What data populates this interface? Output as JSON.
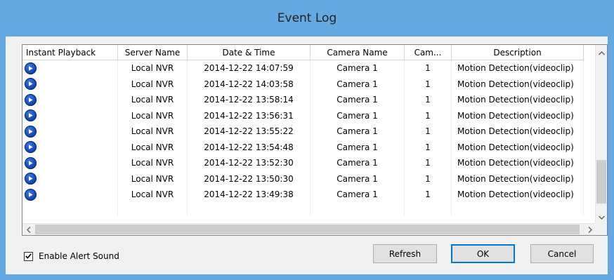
{
  "window": {
    "title": "Event Log"
  },
  "columns": [
    "Instant Playback",
    "Server Name",
    "Date & Time",
    "Camera Name",
    "Cam...",
    "Description"
  ],
  "rows": [
    {
      "playback_icon": "play-circle-icon",
      "server": "Local NVR",
      "datetime": "2014-12-22 14:07:59",
      "camera": "Camera 1",
      "cam": "1",
      "description": "Motion Detection(videoclip)"
    },
    {
      "playback_icon": "play-circle-icon",
      "server": "Local NVR",
      "datetime": "2014-12-22 14:03:58",
      "camera": "Camera 1",
      "cam": "1",
      "description": "Motion Detection(videoclip)"
    },
    {
      "playback_icon": "play-circle-icon",
      "server": "Local NVR",
      "datetime": "2014-12-22 13:58:14",
      "camera": "Camera 1",
      "cam": "1",
      "description": "Motion Detection(videoclip)"
    },
    {
      "playback_icon": "play-circle-icon",
      "server": "Local NVR",
      "datetime": "2014-12-22 13:56:31",
      "camera": "Camera 1",
      "cam": "1",
      "description": "Motion Detection(videoclip)"
    },
    {
      "playback_icon": "play-circle-icon",
      "server": "Local NVR",
      "datetime": "2014-12-22 13:55:22",
      "camera": "Camera 1",
      "cam": "1",
      "description": "Motion Detection(videoclip)"
    },
    {
      "playback_icon": "play-circle-icon",
      "server": "Local NVR",
      "datetime": "2014-12-22 13:54:48",
      "camera": "Camera 1",
      "cam": "1",
      "description": "Motion Detection(videoclip)"
    },
    {
      "playback_icon": "play-circle-icon",
      "server": "Local NVR",
      "datetime": "2014-12-22 13:52:30",
      "camera": "Camera 1",
      "cam": "1",
      "description": "Motion Detection(videoclip)"
    },
    {
      "playback_icon": "play-circle-icon",
      "server": "Local NVR",
      "datetime": "2014-12-22 13:50:30",
      "camera": "Camera 1",
      "cam": "1",
      "description": "Motion Detection(videoclip)"
    },
    {
      "playback_icon": "play-circle-icon",
      "server": "Local NVR",
      "datetime": "2014-12-22 13:49:38",
      "camera": "Camera 1",
      "cam": "1",
      "description": "Motion Detection(videoclip)"
    }
  ],
  "options": {
    "enable_alert_sound_label": "Enable Alert Sound",
    "enable_alert_sound_checked": true
  },
  "buttons": {
    "refresh": "Refresh",
    "ok": "OK",
    "cancel": "Cancel"
  },
  "scrollbars": {
    "up_icon": "chevron-up-icon",
    "down_icon": "chevron-down-icon",
    "left_icon": "chevron-left-icon",
    "right_icon": "chevron-right-icon"
  },
  "colors": {
    "title_bar": "#65a9e3",
    "play_icon": "#1849b8",
    "ok_focus_border": "#0078d7"
  }
}
